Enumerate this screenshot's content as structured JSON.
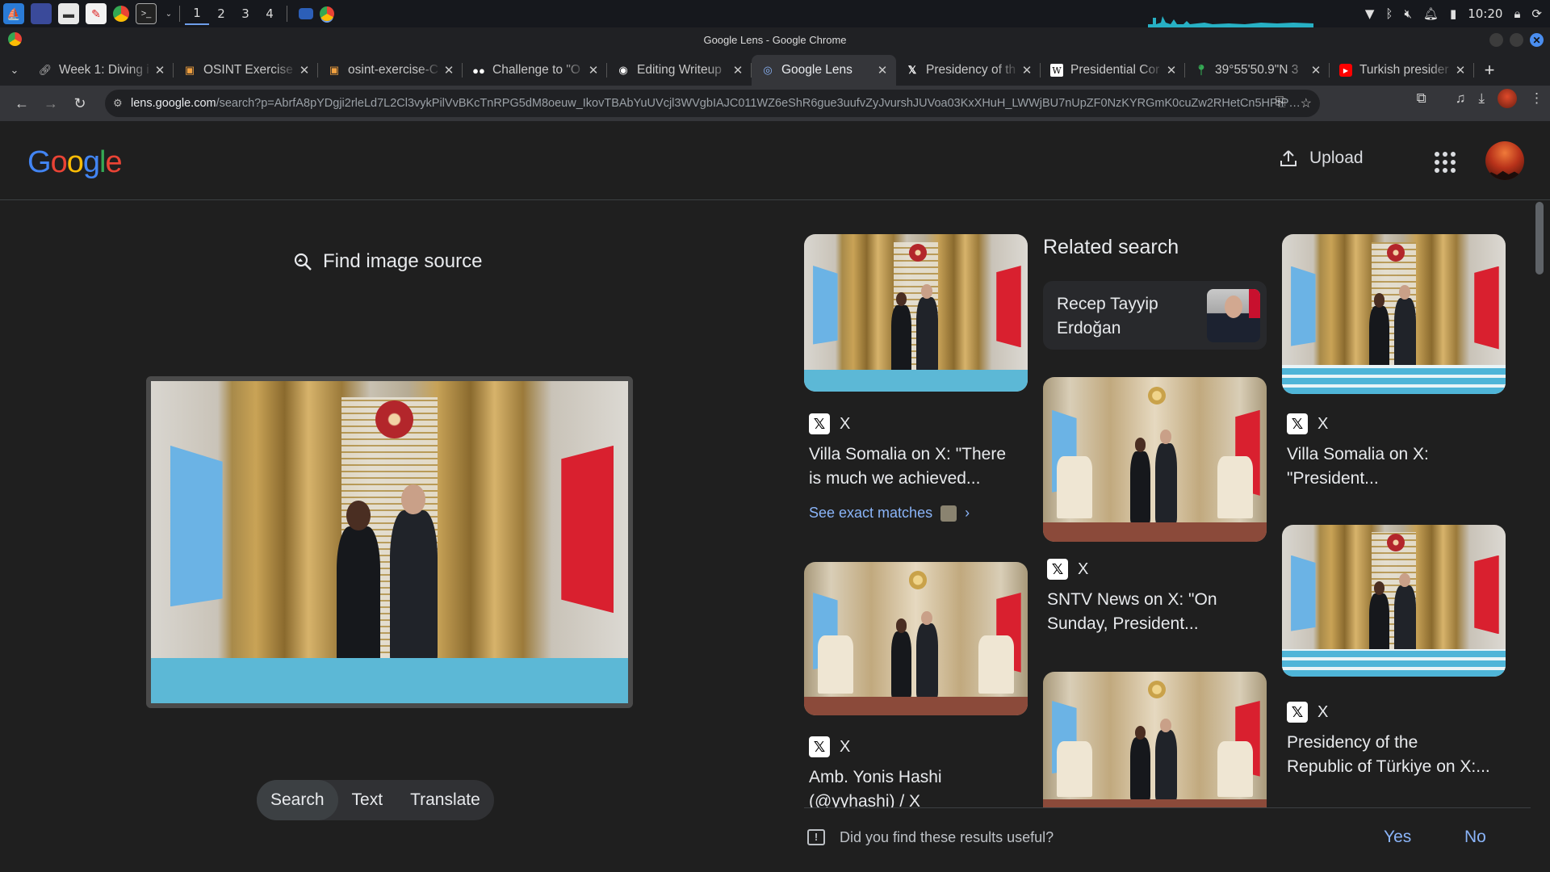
{
  "taskbar": {
    "workspaces": [
      "1",
      "2",
      "3",
      "4"
    ],
    "clock": "10:20",
    "tray_icons": [
      "wifi-icon",
      "bluetooth-icon",
      "mute-icon",
      "bell-icon",
      "battery-icon",
      "lock-icon",
      "power-icon"
    ]
  },
  "window": {
    "title": "Google Lens - Google Chrome"
  },
  "tabs": [
    {
      "icon": "link-icon",
      "title": "Week 1: Diving i",
      "active": false
    },
    {
      "icon": "osint-icon",
      "title": "OSINT Exercise",
      "active": false
    },
    {
      "icon": "osint-icon",
      "title": "osint-exercise-C",
      "active": false
    },
    {
      "icon": "medium-icon",
      "title": "Challenge to \"O",
      "active": false
    },
    {
      "icon": "github-icon",
      "title": "Editing Writeup",
      "active": false
    },
    {
      "icon": "lens-icon",
      "title": "Google Lens",
      "active": true
    },
    {
      "icon": "x-icon",
      "title": "Presidency of th",
      "active": false
    },
    {
      "icon": "wikipedia-icon",
      "title": "Presidential Cor",
      "active": false
    },
    {
      "icon": "maps-pin-icon",
      "title": "39°55'50.9\"N 3",
      "active": false
    },
    {
      "icon": "youtube-icon",
      "title": "Turkish presider",
      "active": false
    }
  ],
  "address_bar": {
    "host": "lens.google.com",
    "path": "/search?p=AbrfA8pYDgji2rleLd7L2Cl3vykPilVvBKcTnRPG5dM8oeuw_IkovTBAbYuUVcjl3WVgbIAJC011WZ6eShR6gue3uufvZyJvurshJUVoa03KxXHuH_LWWjBU7nUpZF0NzKYRGmK0cuZw2RHetCn5HPIPcic9-NTmM8Ye..."
  },
  "lens": {
    "upload_label": "Upload",
    "find_source_label": "Find image source",
    "modes": [
      "Search",
      "Text",
      "Translate"
    ],
    "active_mode": "Search"
  },
  "results": {
    "col1": [
      {
        "source": "X",
        "title": "Villa Somalia on X: \"There is much we achieved...\"",
        "title_line1": "Villa Somalia on X: \"There",
        "title_line2": "is much we achieved..."
      },
      {
        "source": "X",
        "title_line1": "Amb. Yonis Hashi",
        "title_line2": "(@yyhashi) / X"
      }
    ],
    "see_exact_matches": "See exact matches",
    "related_heading": "Related search",
    "related_entity": {
      "line1": "Recep Tayyip",
      "line2": "Erdoğan"
    },
    "col2": [
      {
        "source": "X",
        "title_line1": "SNTV News on X: \"On",
        "title_line2": "Sunday, President..."
      }
    ],
    "col3": [
      {
        "source": "X",
        "title_line1": "Villa Somalia on X:",
        "title_line2": "\"President..."
      },
      {
        "source": "X",
        "title_line1": "Presidency of the",
        "title_line2": "Republic of Türkiye on X:..."
      }
    ]
  },
  "feedback": {
    "question": "Did you find these results useful?",
    "yes": "Yes",
    "no": "No"
  },
  "colors": {
    "page_bg": "#1f1f1f",
    "link_blue": "#8ab4f8",
    "google_blue": "#4285f4",
    "google_red": "#ea4335",
    "google_yellow": "#fbbc05",
    "google_green": "#34a853"
  }
}
